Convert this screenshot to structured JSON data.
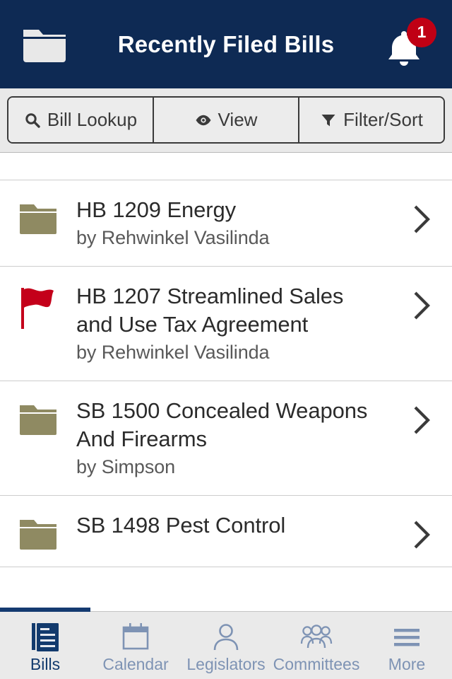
{
  "header": {
    "title": "Recently Filed Bills",
    "left_icon": "folder-icon",
    "right_icon": "bell-icon",
    "notification_count": "1",
    "bg_color": "#0e2a54",
    "badge_color": "#c00014"
  },
  "toolbar": {
    "buttons": [
      {
        "label": "Bill Lookup",
        "icon": "search-icon"
      },
      {
        "label": "View",
        "icon": "eye-icon"
      },
      {
        "label": "Filter/Sort",
        "icon": "filter-icon"
      }
    ]
  },
  "bills": [
    {
      "icon": "folder-icon",
      "title": "HB 1209 Energy",
      "sponsor": "by Rehwinkel Vasilinda",
      "chevron": "chevron-right-icon"
    },
    {
      "icon": "flag-icon",
      "title": "HB 1207 Streamlined Sales and Use Tax Agreement",
      "sponsor": "by Rehwinkel Vasilinda",
      "chevron": "chevron-right-icon"
    },
    {
      "icon": "folder-icon",
      "title": "SB 1500 Concealed Weapons And Firearms",
      "sponsor": "by Simpson",
      "chevron": "chevron-right-icon"
    },
    {
      "icon": "folder-icon",
      "title": "SB 1498 Pest Control",
      "sponsor": "",
      "chevron": "chevron-right-icon"
    }
  ],
  "tabbar": {
    "active": "Bills",
    "active_color": "#123a6d",
    "inactive_color": "#7e93b4",
    "items": [
      {
        "label": "Bills",
        "icon": "bills-document-icon"
      },
      {
        "label": "Calendar",
        "icon": "calendar-icon"
      },
      {
        "label": "Legislators",
        "icon": "person-icon"
      },
      {
        "label": "Committees",
        "icon": "people-group-icon"
      },
      {
        "label": "More",
        "icon": "hamburger-menu-icon"
      }
    ]
  },
  "colors": {
    "folder_khaki": "#8f8a62",
    "flag_red": "#c4001a",
    "navy": "#0e2a54"
  }
}
